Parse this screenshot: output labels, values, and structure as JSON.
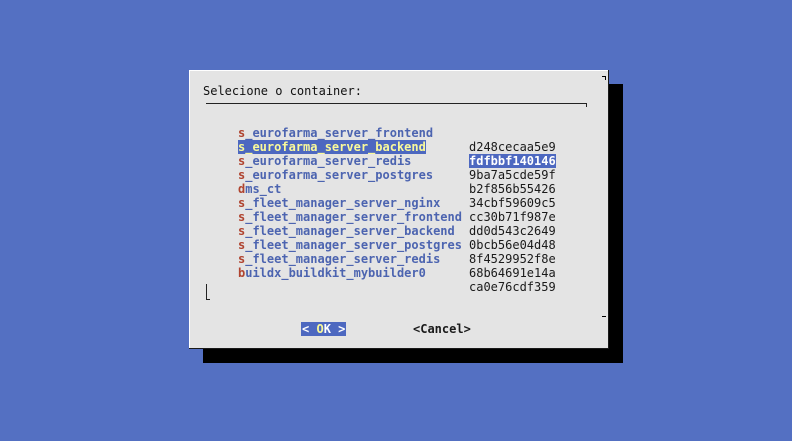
{
  "dialog": {
    "prompt": "Selecione o container:",
    "items": [
      {
        "hot": "s",
        "rest": "_eurofarma_server_frontend",
        "tag": "d248cecaa5e9",
        "selected": false
      },
      {
        "hot": "s",
        "rest": "_eurofarma_server_backend",
        "tag": "fdfbbf140146",
        "selected": true
      },
      {
        "hot": "s",
        "rest": "_eurofarma_server_redis",
        "tag": "9ba7a5cde59f",
        "selected": false
      },
      {
        "hot": "s",
        "rest": "_eurofarma_server_postgres",
        "tag": "b2f856b55426",
        "selected": false
      },
      {
        "hot": "d",
        "rest": "ms_ct",
        "tag": "34cbf59609c5",
        "selected": false
      },
      {
        "hot": "s",
        "rest": "_fleet_manager_server_nginx",
        "tag": "cc30b71f987e",
        "selected": false
      },
      {
        "hot": "s",
        "rest": "_fleet_manager_server_frontend",
        "tag": "dd0d543c2649",
        "selected": false
      },
      {
        "hot": "s",
        "rest": "_fleet_manager_server_backend",
        "tag": "0bcb56e04d48",
        "selected": false
      },
      {
        "hot": "s",
        "rest": "_fleet_manager_server_postgres",
        "tag": "8f4529952f8e",
        "selected": false
      },
      {
        "hot": "s",
        "rest": "_fleet_manager_server_redis",
        "tag": "68b64691e14a",
        "selected": false
      },
      {
        "hot": "b",
        "rest": "uildx_buildkit_mybuilder0",
        "tag": "ca0e76cdf359",
        "selected": false
      }
    ],
    "ok_button": {
      "left": "< ",
      "hot": "O",
      "rest": "K",
      "right": " >"
    },
    "cancel_button": "<Cancel>"
  },
  "colors": {
    "background": "#5470c2",
    "dialog": "#e4e4e4",
    "highlight": "#4d68c0",
    "hotkey": "#b0442f",
    "item_text": "#4c64b0"
  }
}
